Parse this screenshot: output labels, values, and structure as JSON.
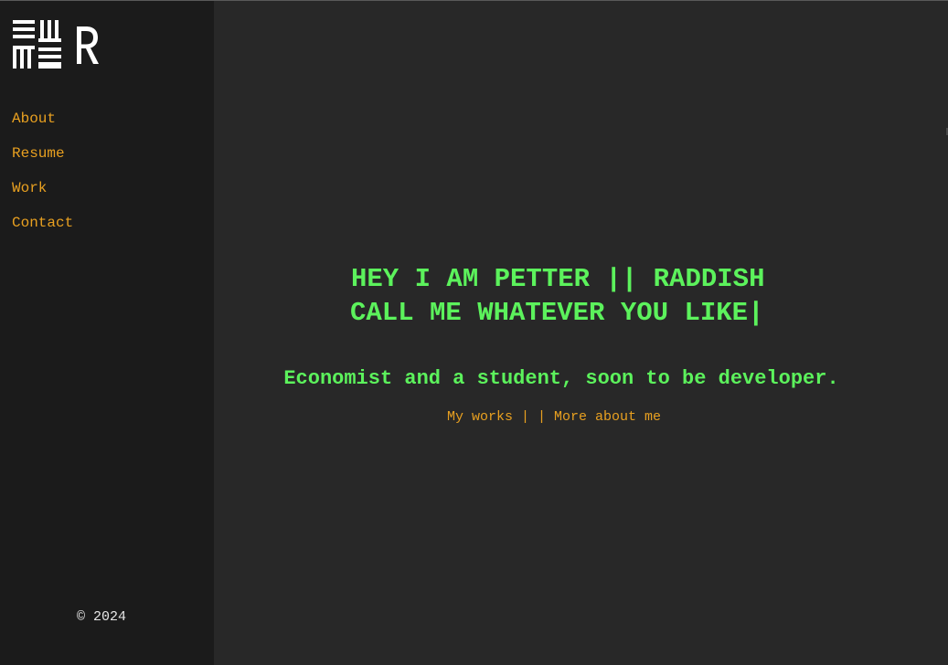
{
  "colors": {
    "accent_orange": "#e8a020",
    "headline_green": "#5cf25c",
    "sidebar_bg": "#1b1b1b",
    "main_bg": "#282828",
    "logo_white": "#ffffff"
  },
  "sidebar": {
    "logo": {
      "icon": "maze-grid-icon",
      "letter": "R"
    },
    "nav": [
      {
        "label": "About"
      },
      {
        "label": "Resume"
      },
      {
        "label": "Work"
      },
      {
        "label": "Contact"
      }
    ],
    "copyright": "© 2024"
  },
  "hero": {
    "headline_line1": "HEY I AM PETTER || RADDISH",
    "headline_line2": "CALL ME WHATEVER YOU LIKE|",
    "subtitle": "Economist and a student, soon to be developer.",
    "link_works": "My works",
    "separator": " | | ",
    "link_more": "More about me"
  }
}
